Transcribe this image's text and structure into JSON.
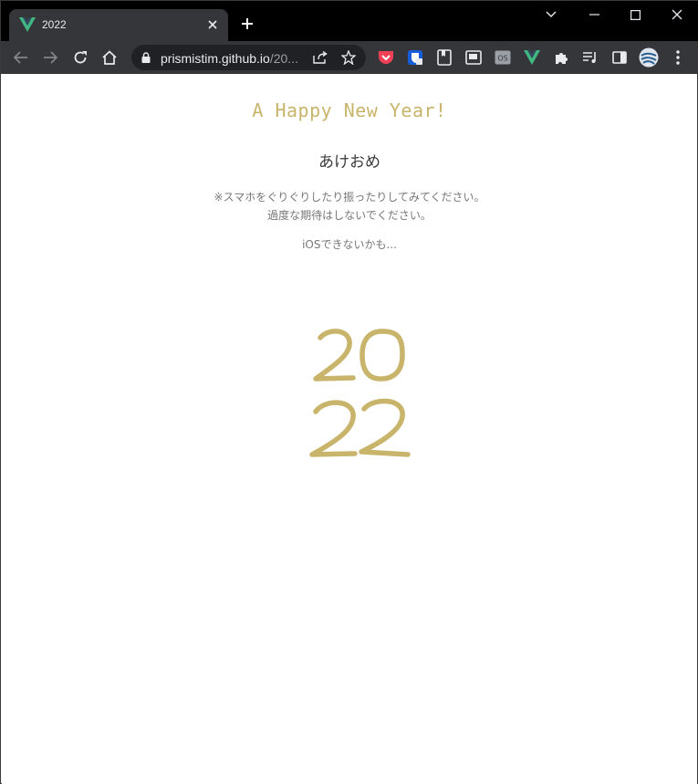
{
  "browser": {
    "tab_title": "2022",
    "url_host": "prismistim.github.io",
    "url_rest": "/20...",
    "extensions": [
      "pocket-icon",
      "bitwarden-icon",
      "reading-list-icon",
      "picture-in-picture-icon",
      "os-icon",
      "vue-devtools-icon",
      "puzzle-icon",
      "media-control-icon",
      "side-panel-icon",
      "profile-avatar"
    ]
  },
  "page": {
    "heading": "A Happy New Year!",
    "subheading": "あけおめ",
    "note_line1": "※スマホをぐりぐりしたり振ったりしてみてください。",
    "note_line2": "過度な期待はしないでください。",
    "note_ios": "iOSできないかも...",
    "year_top": "20",
    "year_bottom": "22"
  },
  "colors": {
    "accent_gold": "#c8b46a",
    "tab_bg": "#35363a",
    "vue_green": "#41b883"
  }
}
